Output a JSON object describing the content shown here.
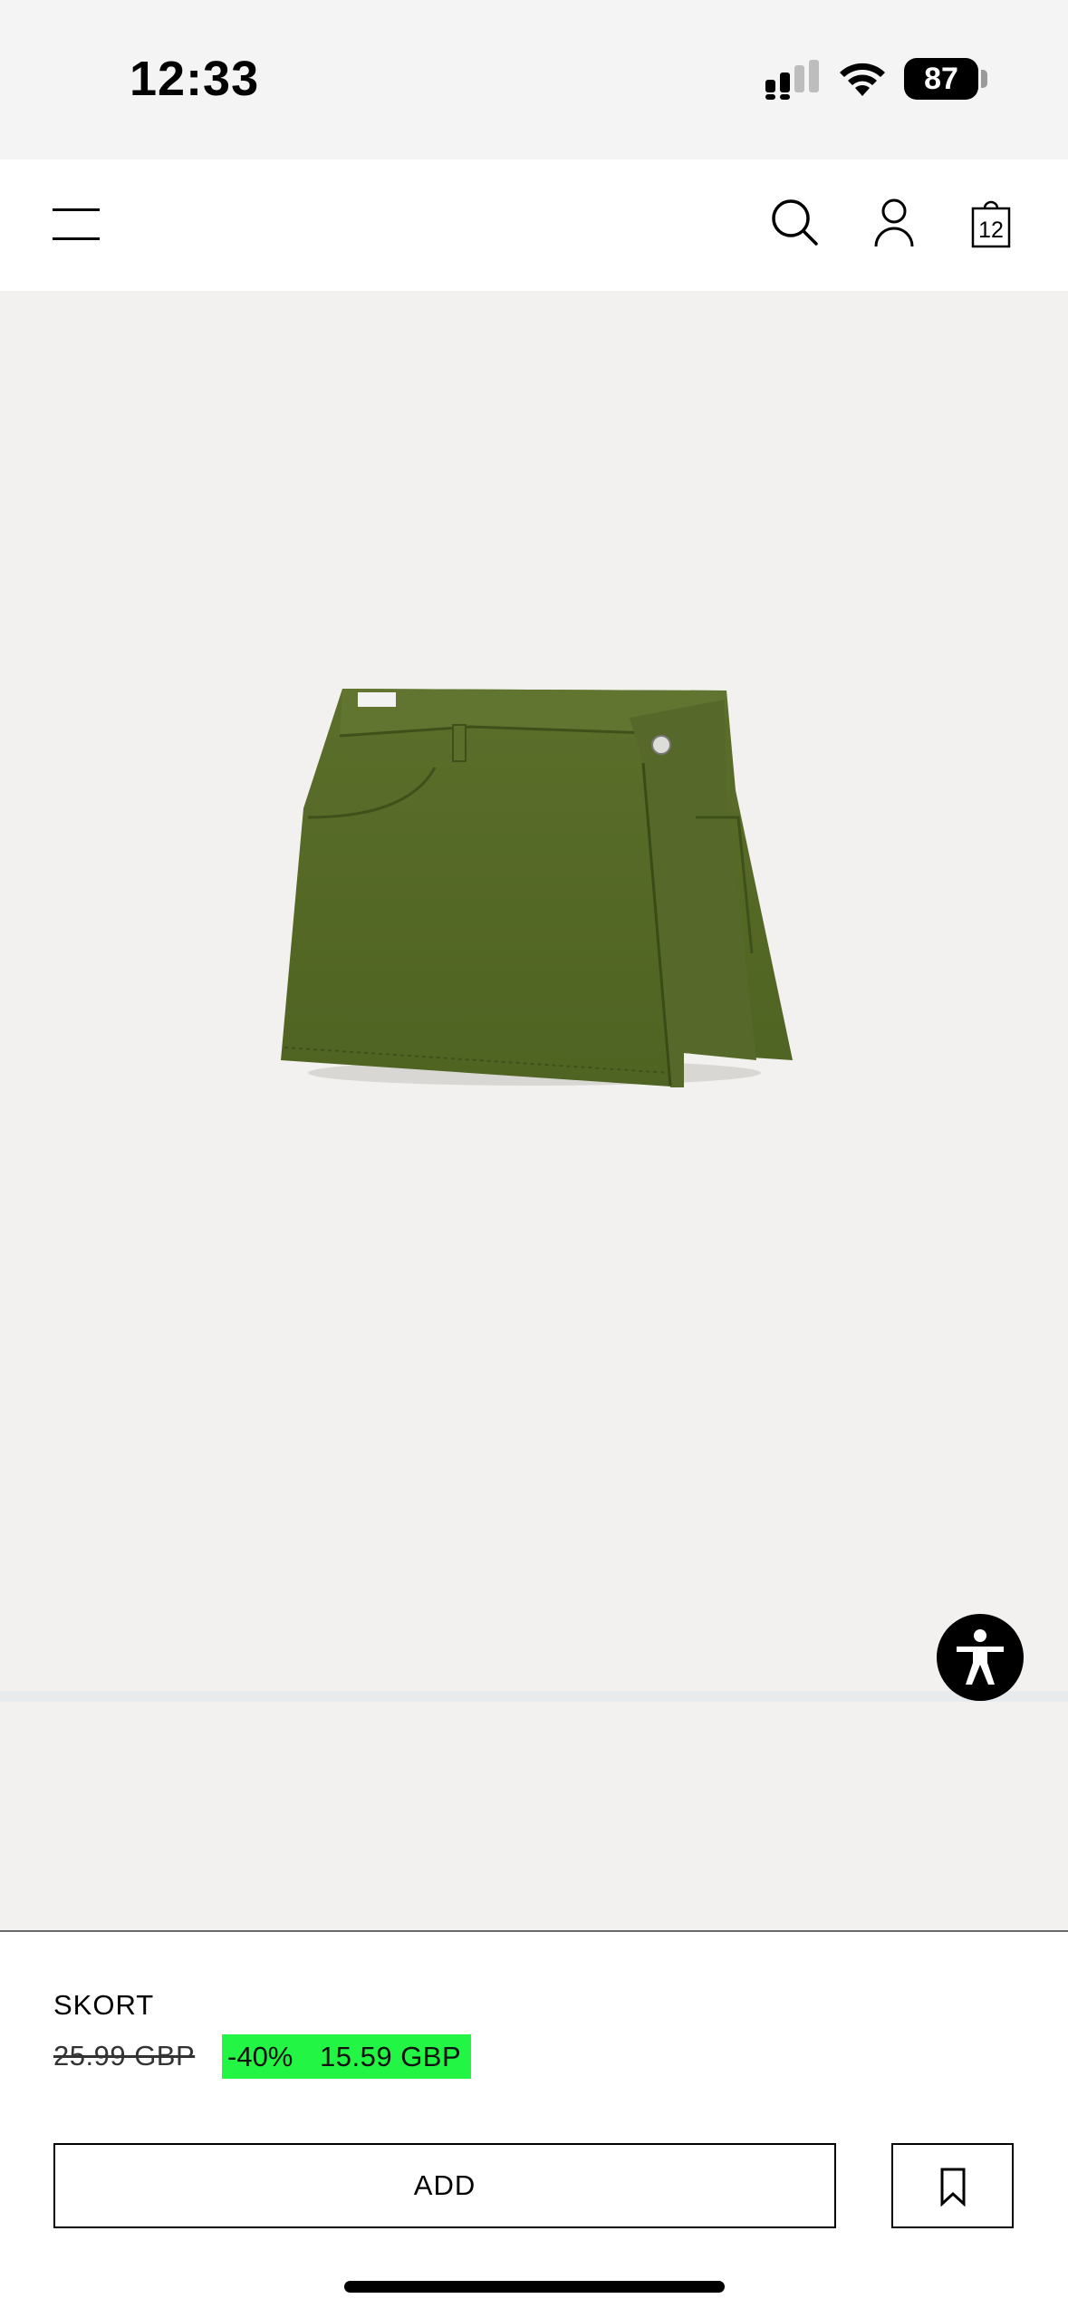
{
  "status_bar": {
    "time": "12:33",
    "battery": "87",
    "icons": [
      "signal-icon",
      "wifi-icon",
      "battery-icon"
    ]
  },
  "nav": {
    "icons": [
      "menu-icon",
      "search-icon",
      "account-icon",
      "shopping-bag-icon"
    ],
    "bag_count": "12"
  },
  "product": {
    "image": "olive-green-denim-wrap-skort",
    "name": "SKORT",
    "price_original": "25.99 GBP",
    "discount": "-40%",
    "price_sale": "15.59 GBP",
    "sale_highlight_color": "#22f543"
  },
  "actions": {
    "add_label": "ADD",
    "save_icon": "bookmark-icon"
  },
  "accessibility": {
    "icon": "accessibility-icon"
  }
}
